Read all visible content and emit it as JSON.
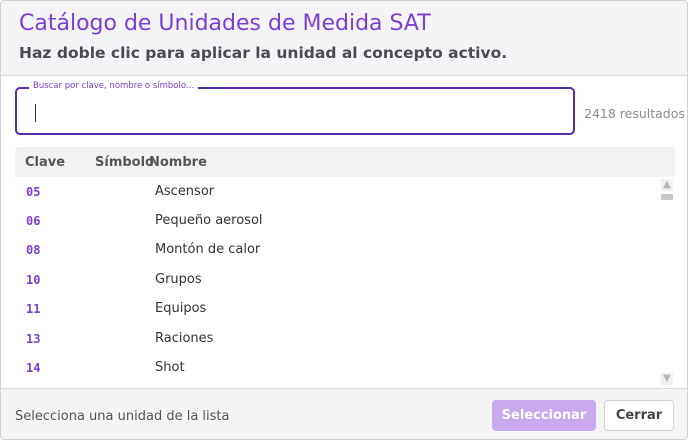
{
  "header": {
    "title": "Catálogo de Unidades de Medida SAT",
    "subtitle": "Haz doble clic para aplicar la unidad al concepto activo."
  },
  "search": {
    "legend": "Buscar por clave, nombre o símbolo...",
    "value": "",
    "results": "2418 resultados"
  },
  "table": {
    "columns": [
      "Clave",
      "Símbolo",
      "Nombre"
    ],
    "rows": [
      {
        "clave": "05",
        "simbolo": "",
        "nombre": "Ascensor"
      },
      {
        "clave": "06",
        "simbolo": "",
        "nombre": "Pequeño aerosol"
      },
      {
        "clave": "08",
        "simbolo": "",
        "nombre": "Montón de calor"
      },
      {
        "clave": "10",
        "simbolo": "",
        "nombre": "Grupos"
      },
      {
        "clave": "11",
        "simbolo": "",
        "nombre": "Equipos"
      },
      {
        "clave": "13",
        "simbolo": "",
        "nombre": "Raciones"
      },
      {
        "clave": "14",
        "simbolo": "",
        "nombre": "Shot"
      }
    ]
  },
  "footer": {
    "status": "Selecciona una unidad de la lista",
    "select_label": "Seleccionar",
    "cancel_label": "Cerrar"
  },
  "colors": {
    "accent": "#7b3fd4",
    "button_disabled": "#c9a9f0"
  }
}
